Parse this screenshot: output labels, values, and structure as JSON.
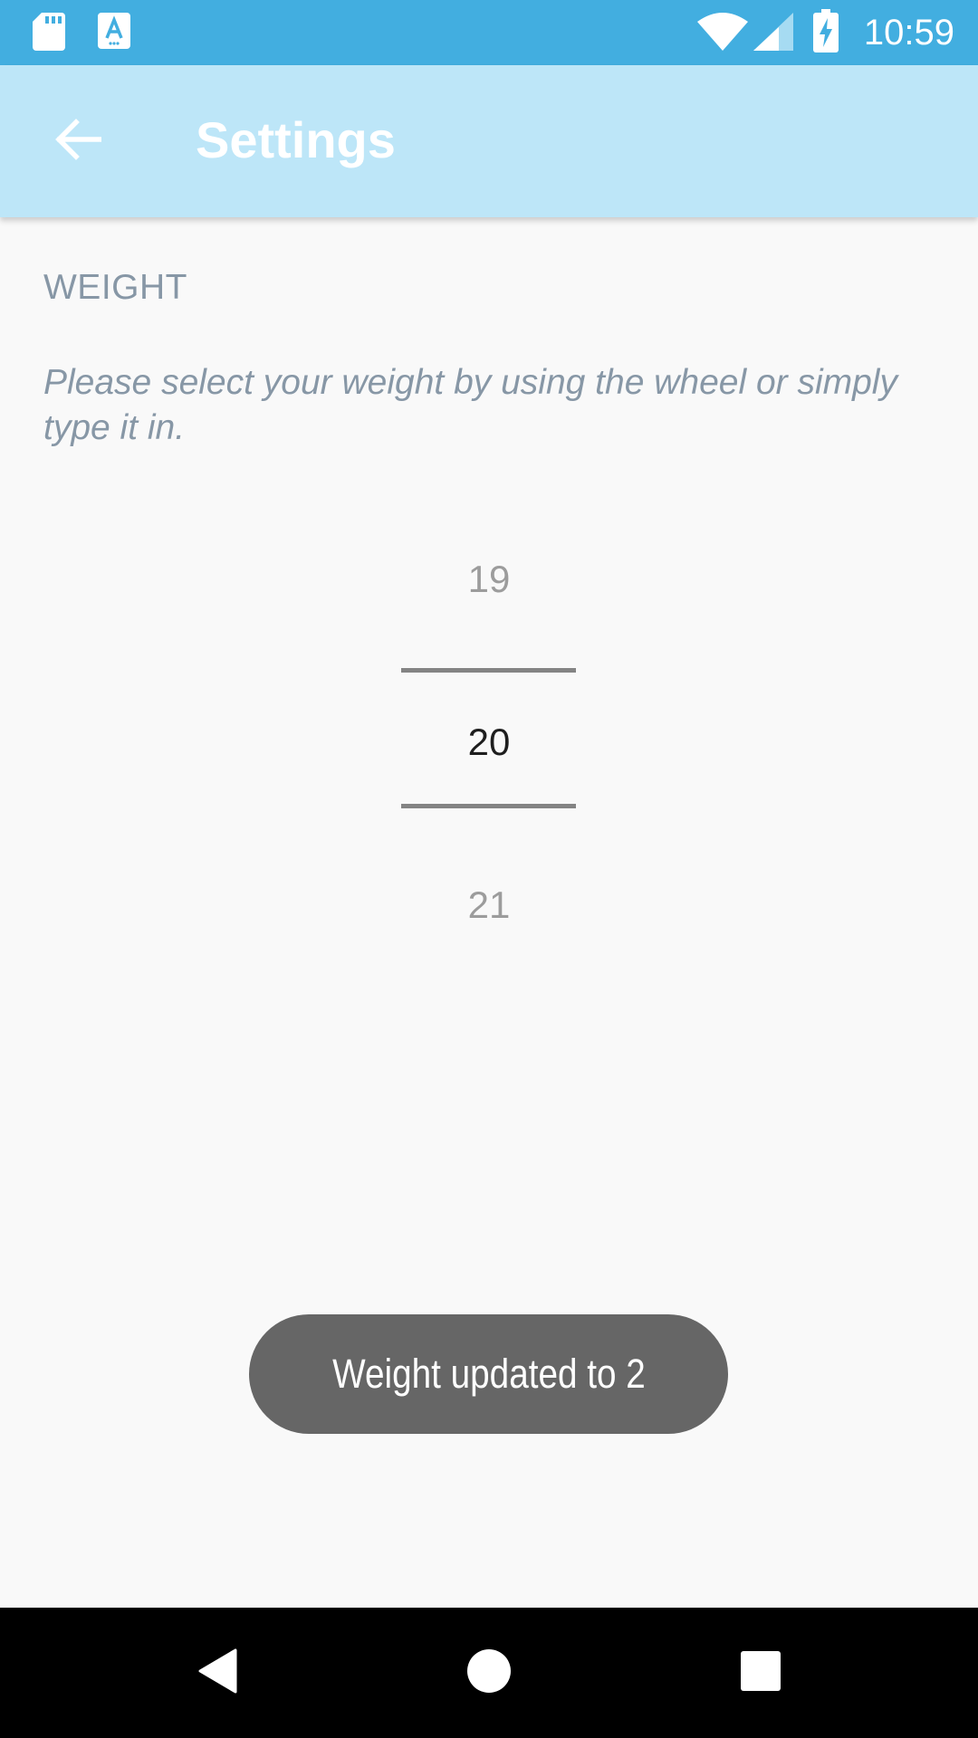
{
  "status_bar": {
    "time": "10:59",
    "icons": [
      "sd-card-icon",
      "font-download-icon",
      "wifi-icon",
      "cell-signal-icon",
      "battery-charging-icon"
    ]
  },
  "app_bar": {
    "title": "Settings",
    "back_icon": "arrow-back-icon"
  },
  "content": {
    "section_header": "WEIGHT",
    "description": "Please select your weight by using the wheel or simply type it in."
  },
  "picker": {
    "previous_value": "19",
    "selected_value": "20",
    "next_value": "21"
  },
  "toast": {
    "message": "Weight updated to 2"
  },
  "nav_bar": {
    "buttons": [
      "back-triangle-icon",
      "home-circle-icon",
      "recents-square-icon"
    ]
  },
  "colors": {
    "status_bar": "#42aee0",
    "app_bar": "#bde6f8",
    "background": "#f9f9f9",
    "secondary_text": "#8797a6",
    "toast": "#666666",
    "nav_bar": "#000000"
  }
}
